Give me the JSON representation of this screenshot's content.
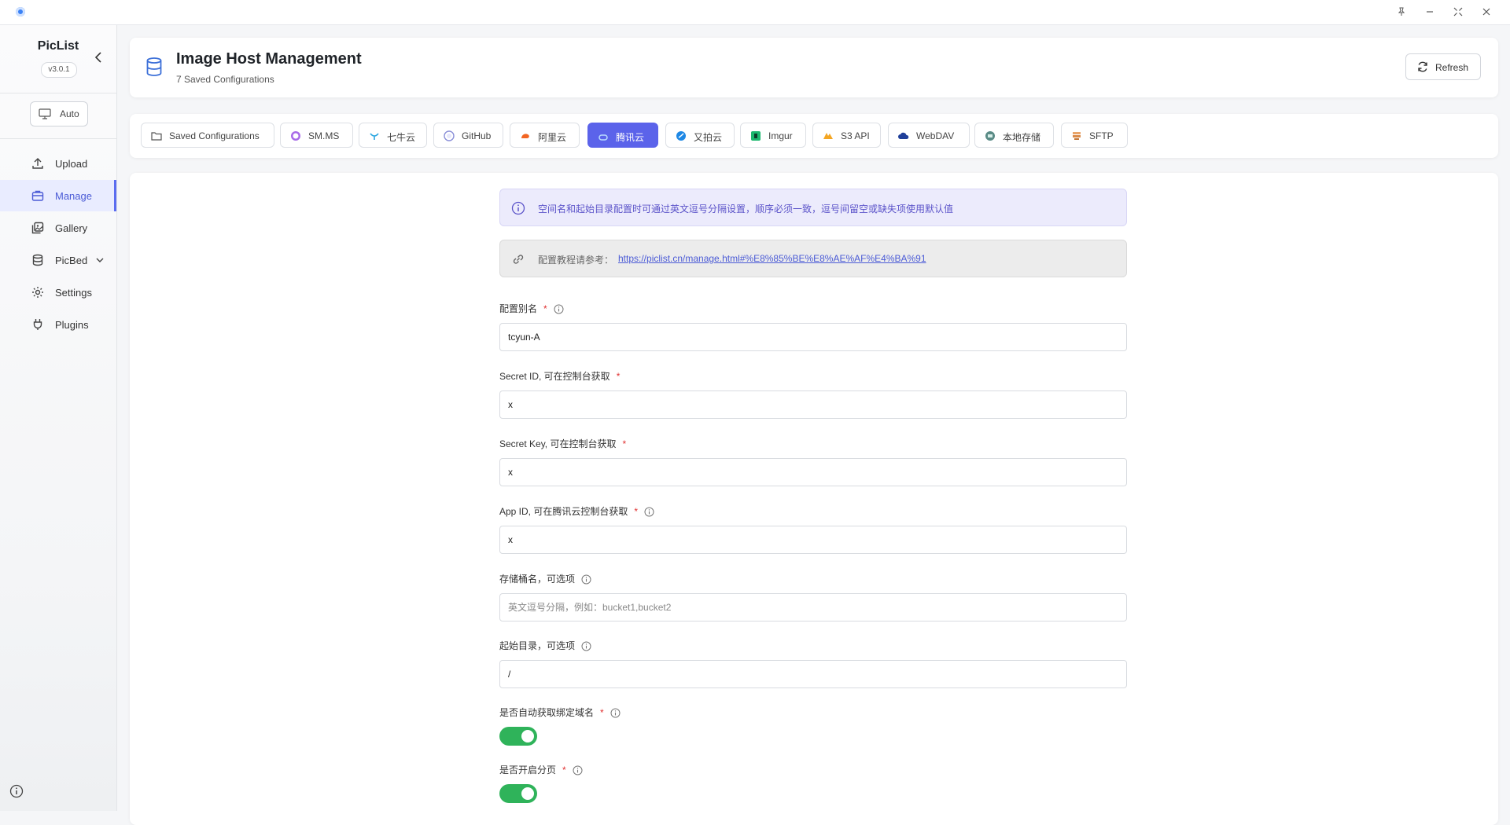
{
  "app": {
    "name": "PicList",
    "version": "v3.0.1"
  },
  "sidebar": {
    "auto_label": "Auto",
    "items": [
      {
        "label": "Upload"
      },
      {
        "label": "Manage"
      },
      {
        "label": "Gallery"
      },
      {
        "label": "PicBed"
      },
      {
        "label": "Settings"
      },
      {
        "label": "Plugins"
      }
    ]
  },
  "header": {
    "title": "Image Host Management",
    "subtitle": "7 Saved Configurations",
    "refresh_label": "Refresh"
  },
  "tabs": [
    {
      "label": "Saved Configurations"
    },
    {
      "label": "SM.MS"
    },
    {
      "label": "七牛云"
    },
    {
      "label": "GitHub"
    },
    {
      "label": "阿里云"
    },
    {
      "label": "腾讯云"
    },
    {
      "label": "又拍云"
    },
    {
      "label": "Imgur"
    },
    {
      "label": "S3 API"
    },
    {
      "label": "WebDAV"
    },
    {
      "label": "本地存储"
    },
    {
      "label": "SFTP"
    }
  ],
  "active_tab": "腾讯云",
  "notice": "空间名和起始目录配置时可通过英文逗号分隔设置，顺序必须一致，逗号间留空或缺失项使用默认值",
  "tutorial": {
    "prefix": "配置教程请参考：",
    "url": "https://piclist.cn/manage.html#%E8%85%BE%E8%AE%AF%E4%BA%91"
  },
  "form": {
    "alias": {
      "label": "配置别名",
      "value": "tcyun-A"
    },
    "secret_id": {
      "label": "Secret ID, 可在控制台获取",
      "value": "x"
    },
    "secret_key": {
      "label": "Secret Key, 可在控制台获取",
      "value": "x"
    },
    "app_id": {
      "label": "App ID, 可在腾讯云控制台获取",
      "value": "x"
    },
    "bucket": {
      "label": "存储桶名，可选项",
      "value": "",
      "placeholder": "英文逗号分隔，例如：bucket1,bucket2"
    },
    "base_dir": {
      "label": "起始目录，可选项",
      "value": "/"
    },
    "auto_domain": {
      "label": "是否自动获取绑定域名",
      "enabled": true
    },
    "paging": {
      "label": "是否开启分页",
      "enabled": true
    }
  },
  "required_mark": "*",
  "colors": {
    "accent": "#5b63ea",
    "toggle_on": "#2fb35a",
    "required": "#e03131"
  }
}
